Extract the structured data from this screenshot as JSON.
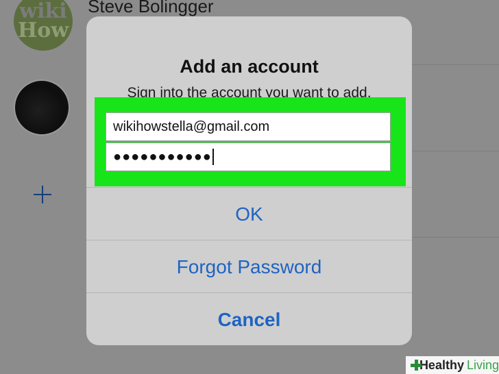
{
  "background": {
    "account_name": "Steve Bolingger",
    "avatar_logo_line1": "wiki",
    "avatar_logo_line2": "How"
  },
  "dialog": {
    "title": "Add an account",
    "message": "Sign into the account you want to add.",
    "email_value": "wikihowstella@gmail.com",
    "password_value": "●●●●●●●●●●●",
    "ok_label": "OK",
    "forgot_label": "Forgot Password",
    "cancel_label": "Cancel",
    "highlight_color": "#17e51a",
    "action_color": "#1f63c3"
  },
  "watermark": {
    "brand_bold": "Healthy",
    "brand_light": "Living"
  },
  "icons": {
    "add_account": "plus-icon",
    "watermark_mark": "cross-icon"
  }
}
